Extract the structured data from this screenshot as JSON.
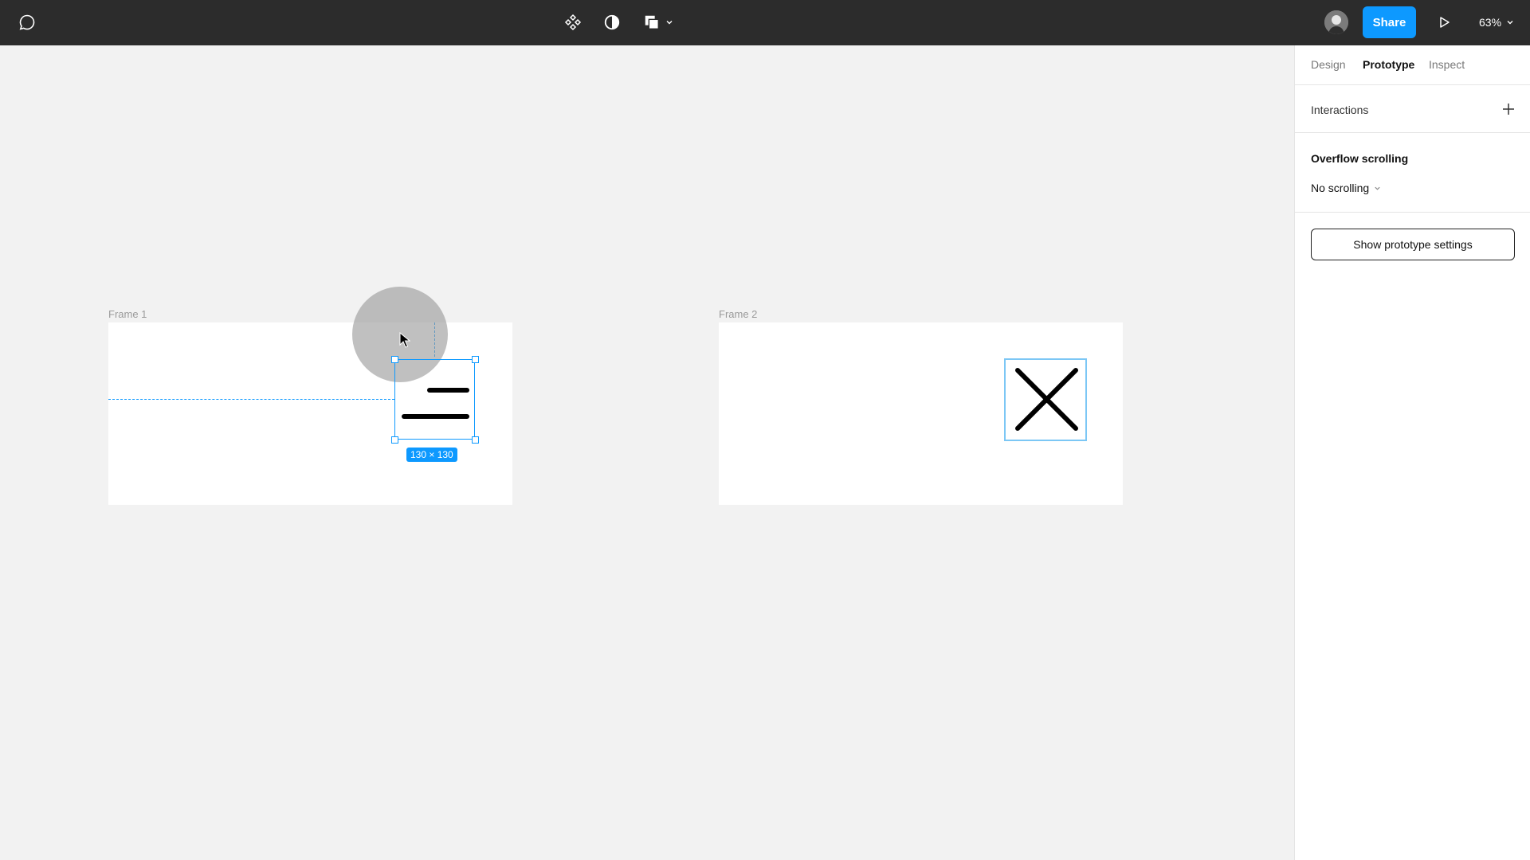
{
  "toolbar": {
    "comment_icon": "speech-bubble-icon",
    "component_icon": "component-diamond-icon",
    "theme_icon": "contrast-circle-icon",
    "shape_icon": "shape-layers-icon",
    "share_label": "Share",
    "play_icon": "play-icon",
    "zoom": "63%",
    "colors": {
      "bg": "#2c2c2c",
      "share": "#0d99ff"
    }
  },
  "canvas": {
    "frame1": {
      "label": "Frame 1",
      "selected_icon": "menu-lines-icon",
      "size_badge": "130 × 130"
    },
    "frame2": {
      "label": "Frame 2",
      "icon": "close-x-icon"
    }
  },
  "panel": {
    "tabs": [
      "Design",
      "Prototype",
      "Inspect"
    ],
    "active_tab": "Prototype",
    "interactions": {
      "title": "Interactions",
      "add_icon": "plus-icon"
    },
    "overflow": {
      "title": "Overflow scrolling",
      "value": "No scrolling"
    },
    "settings_button": "Show prototype settings"
  }
}
